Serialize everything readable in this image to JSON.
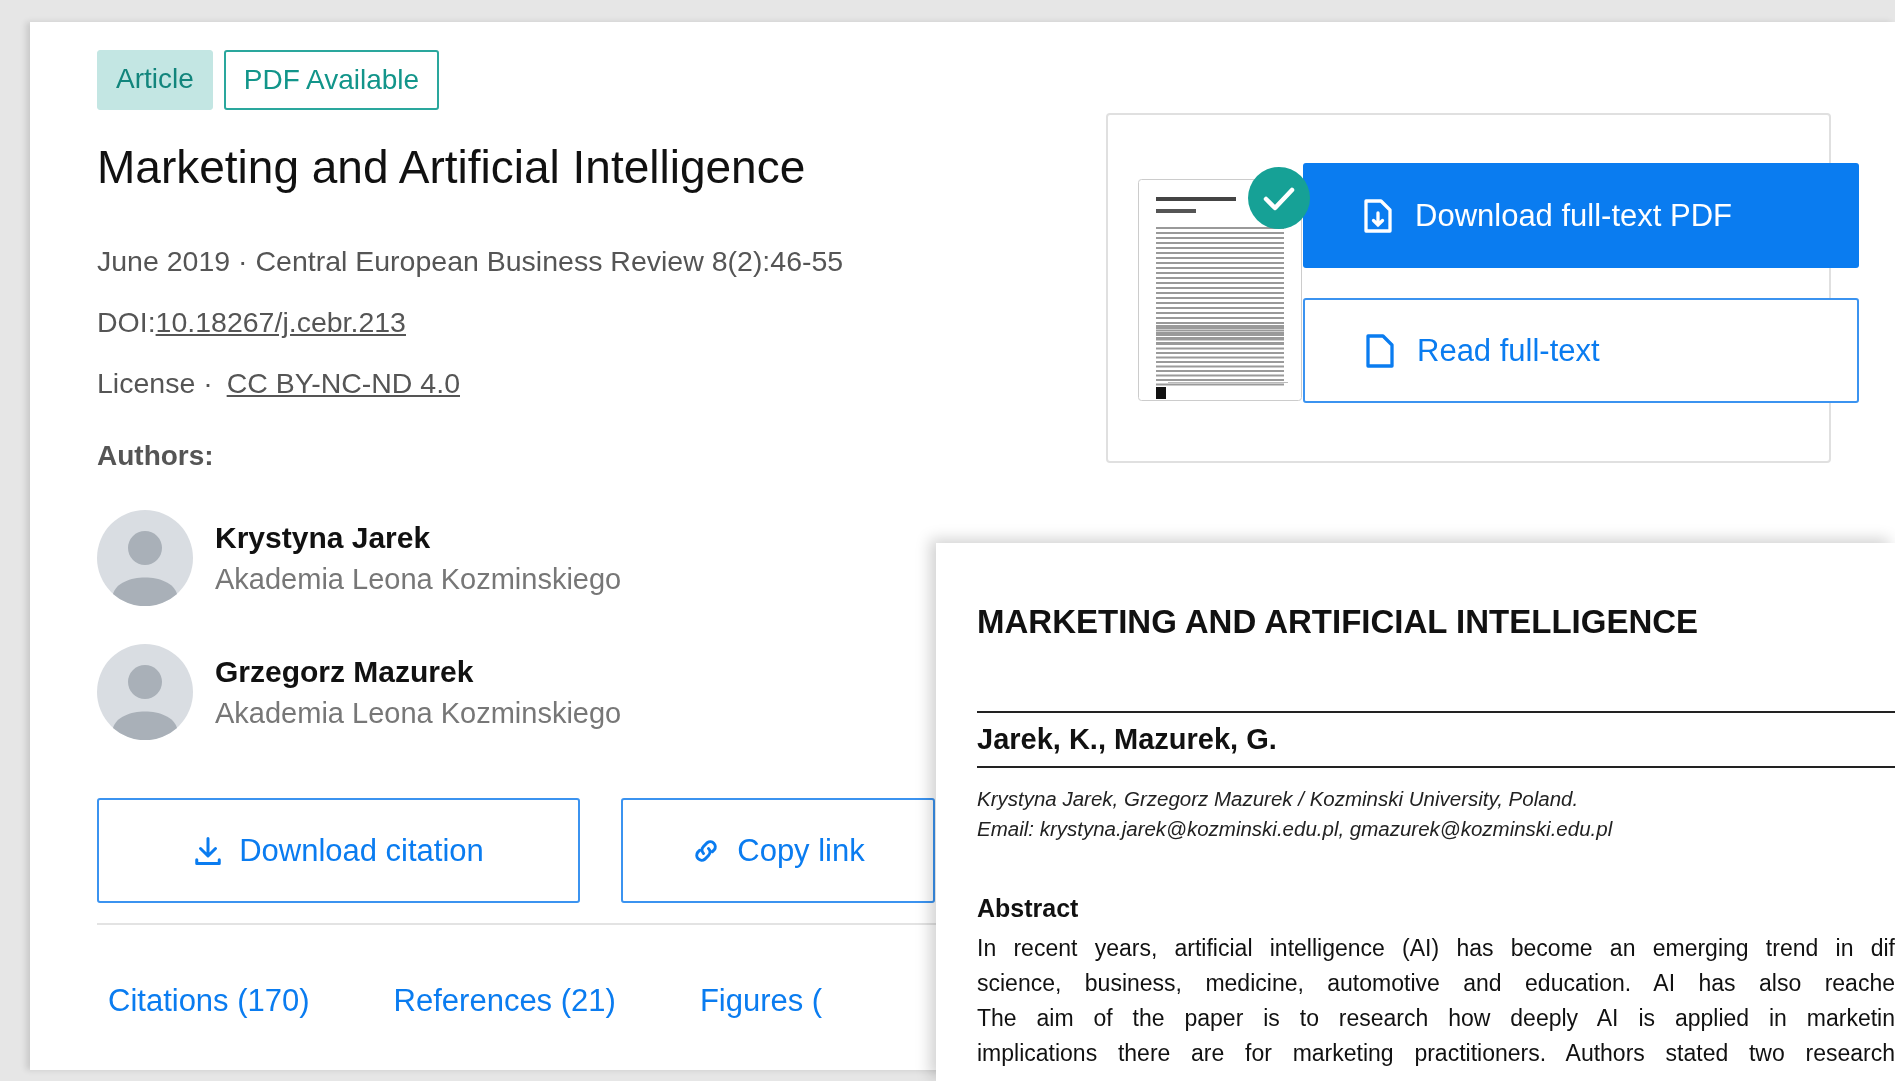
{
  "badges": [
    {
      "label": "Article",
      "kind": "filled"
    },
    {
      "label": "PDF Available",
      "kind": "outline"
    }
  ],
  "title": "Marketing and Artificial Intelligence",
  "meta": "June 2019 · Central European Business Review 8(2):46-55",
  "doi": {
    "label": "DOI:",
    "link": "10.18267/j.cebr.213"
  },
  "license": {
    "label": "License ·",
    "link": "CC BY-NC-ND 4.0"
  },
  "authors_heading": "Authors:",
  "authors": [
    {
      "name": "Krystyna Jarek",
      "affiliation": "Akademia Leona Kozminskiego"
    },
    {
      "name": "Grzegorz Mazurek",
      "affiliation": "Akademia Leona Kozminskiego"
    }
  ],
  "actions": [
    {
      "label": "Download citation",
      "kind": "download"
    },
    {
      "label": "Copy link",
      "kind": "link"
    }
  ],
  "tabs": [
    {
      "label": "Citations (170)",
      "selected": false
    },
    {
      "label": "References (21)",
      "selected": false
    },
    {
      "label": "Figures (",
      "selected": false
    }
  ],
  "fulltext": {
    "primary_button": "Download full-text PDF",
    "secondary_button": "Read full-text"
  },
  "preview": {
    "title": "MARKETING AND ARTIFICIAL INTELLIGENCE",
    "authors": "Jarek, K., Mazurek, G.",
    "affiliation": "Krystyna Jarek, Grzegorz Mazurek / Kozminski University, Poland.",
    "email": "Email: krystyna.jarek@kozminski.edu.pl, gmazurek@kozminski.edu.pl",
    "abstract_heading": "Abstract",
    "abstract_lines": [
      "In recent years, artificial intelligence (AI) has become an emerging trend in dif",
      "science, business, medicine, automotive and education. AI has also reache",
      "The aim of the paper is to research how deeply AI is applied in marketin",
      "implications there are for marketing practitioners. Authors stated two research"
    ]
  }
}
